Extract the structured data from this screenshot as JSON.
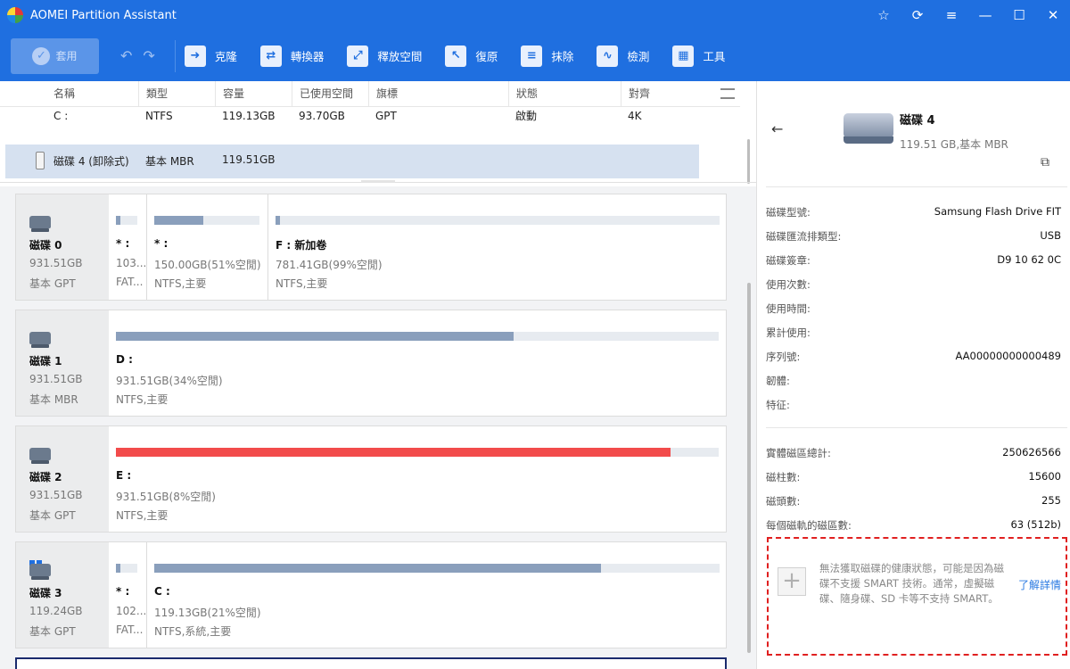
{
  "app": {
    "title": "AOMEI Partition Assistant"
  },
  "window_controls": [
    "☆",
    "⟳",
    "≡",
    "—",
    "☐",
    "✕"
  ],
  "toolbar": {
    "apply_label": "套用",
    "tools": [
      {
        "label": "克隆",
        "icon": "clone-icon"
      },
      {
        "label": "轉換器",
        "icon": "convert-icon"
      },
      {
        "label": "釋放空間",
        "icon": "free-space-icon"
      },
      {
        "label": "復原",
        "icon": "recover-icon"
      },
      {
        "label": "抹除",
        "icon": "wipe-icon"
      },
      {
        "label": "檢測",
        "icon": "test-icon"
      },
      {
        "label": "工具",
        "icon": "tools-icon"
      }
    ]
  },
  "list": {
    "headers": [
      "名稱",
      "類型",
      "容量",
      "已使用空間",
      "旗標",
      "狀態",
      "對齊"
    ],
    "rows": [
      {
        "name": "C :",
        "type": "NTFS",
        "capacity": "119.13GB",
        "used": "93.70GB",
        "flag": "GPT",
        "status": "啟動",
        "align": "4K"
      }
    ],
    "selected_disk": {
      "name": "磁碟 4 (卸除式)",
      "type": "基本 MBR",
      "capacity": "119.51GB"
    }
  },
  "disks": [
    {
      "name": "磁碟 0",
      "size": "931.51GB",
      "type": "基本 GPT",
      "partitions": [
        {
          "label": "* :",
          "size": "103...",
          "fs": "FAT...",
          "used_fraction": 0.2
        },
        {
          "label": "* :",
          "size": "150.00GB(51%空閒)",
          "fs": "NTFS,主要",
          "used_fraction": 0.47
        },
        {
          "label": "F : 新加卷",
          "size": "781.41GB(99%空閒)",
          "fs": "NTFS,主要",
          "used_fraction": 0.01
        }
      ]
    },
    {
      "name": "磁碟 1",
      "size": "931.51GB",
      "type": "基本 MBR",
      "partitions": [
        {
          "label": "D :",
          "size": "931.51GB(34%空閒)",
          "fs": "NTFS,主要",
          "used_fraction": 0.66
        }
      ]
    },
    {
      "name": "磁碟 2",
      "size": "931.51GB",
      "type": "基本 GPT",
      "partitions": [
        {
          "label": "E :",
          "size": "931.51GB(8%空閒)",
          "fs": "NTFS,主要",
          "used_fraction": 0.92,
          "color": "#f24b4b"
        }
      ]
    },
    {
      "name": "磁碟 3",
      "size": "119.24GB",
      "type": "基本 GPT",
      "partitions": [
        {
          "label": "* :",
          "size": "102...",
          "fs": "FAT...",
          "used_fraction": 0.2
        },
        {
          "label": "C :",
          "size": "119.13GB(21%空閒)",
          "fs": "NTFS,系統,主要",
          "used_fraction": 0.79
        }
      ]
    }
  ],
  "details": {
    "title": "磁碟 4",
    "subtitle": "119.51 GB,基本 MBR",
    "rows1": [
      {
        "k": "磁碟型號:",
        "v": "Samsung Flash Drive FIT"
      },
      {
        "k": "磁碟匯流排類型:",
        "v": "USB"
      },
      {
        "k": "磁碟簽章:",
        "v": "D9 10 62 0C"
      },
      {
        "k": "使用次數:",
        "v": ""
      },
      {
        "k": "使用時間:",
        "v": ""
      },
      {
        "k": "累計使用:",
        "v": ""
      },
      {
        "k": "序列號:",
        "v": "AA00000000000489"
      },
      {
        "k": "韌體:",
        "v": ""
      },
      {
        "k": "特征:",
        "v": ""
      }
    ],
    "rows2": [
      {
        "k": "實體磁區總計:",
        "v": "250626566"
      },
      {
        "k": "磁柱數:",
        "v": "15600"
      },
      {
        "k": "磁頭數:",
        "v": "255"
      },
      {
        "k": "每個磁軌的磁區數:",
        "v": "63 (512b)"
      }
    ],
    "smart_message": "無法獲取磁碟的健康狀態，可能是因為磁碟不支援 SMART 技術。通常，虛擬磁碟、隨身碟、SD 卡等不支持 SMART。",
    "learn_more": "了解詳情"
  }
}
